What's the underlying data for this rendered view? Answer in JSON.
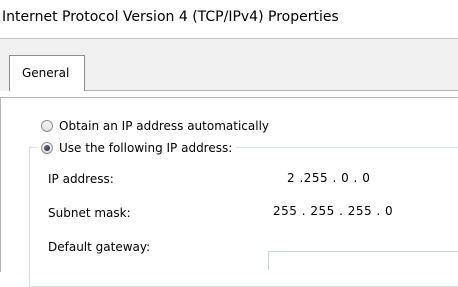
{
  "window": {
    "title": "Internet Protocol Version 4 (TCP/IPv4) Properties"
  },
  "tabs": [
    {
      "label": "General",
      "selected": true
    }
  ],
  "options": {
    "obtain_auto": {
      "label": "Obtain an IP address automatically",
      "selected": false
    },
    "use_following": {
      "label": "Use the following IP address:",
      "selected": true
    }
  },
  "fields": {
    "ip_address": {
      "label": "IP address:",
      "value": "2 .255 . 0 . 0"
    },
    "subnet_mask": {
      "label": "Subnet mask:",
      "value": "255 . 255 . 255 . 0"
    },
    "default_gateway": {
      "label": "Default gateway:",
      "value": ""
    }
  }
}
